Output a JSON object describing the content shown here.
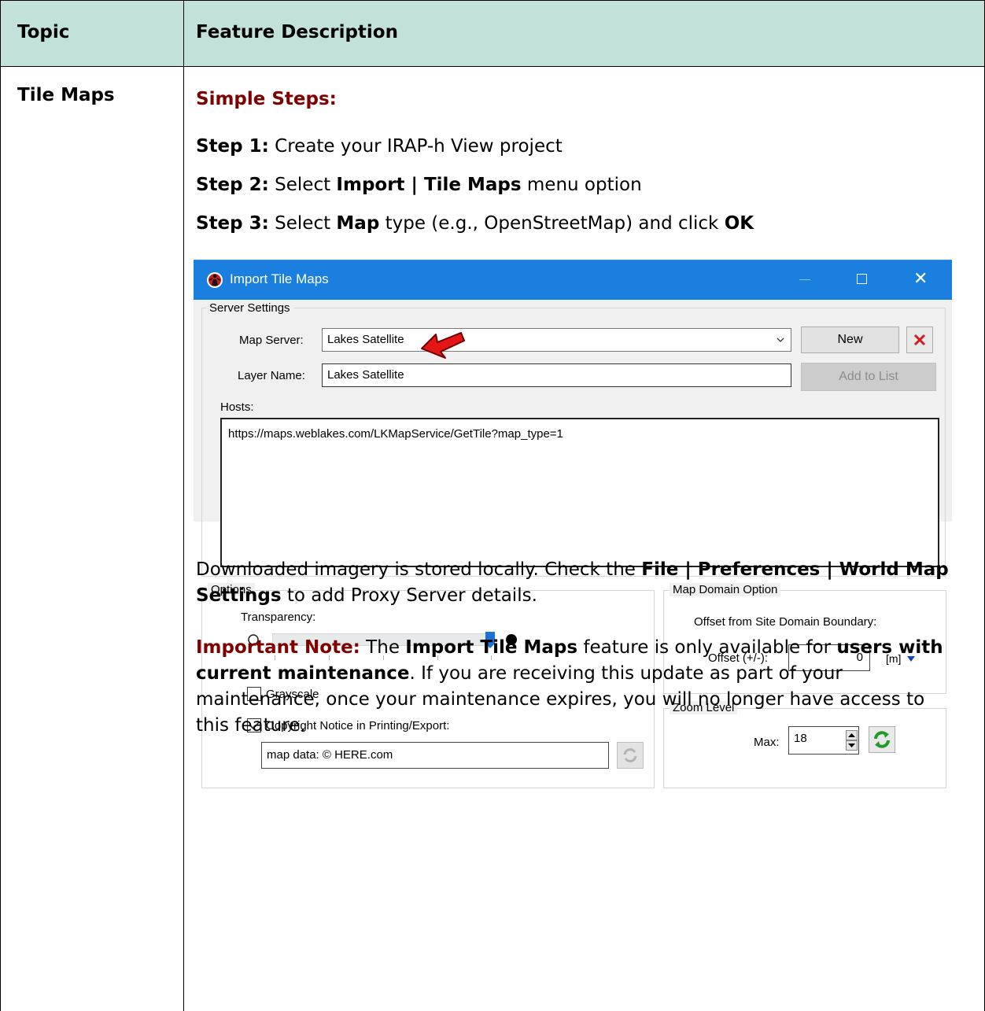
{
  "table": {
    "headers": [
      "Topic",
      "Feature Description"
    ],
    "topic": "Tile Maps",
    "simple_steps_heading": "Simple Steps:",
    "steps": [
      {
        "label": "Step 1:",
        "parts": [
          " Create your IRAP-h View project"
        ]
      },
      {
        "label": "Step 2:",
        "parts": [
          " Select ",
          "Import | Tile Maps",
          " menu option"
        ]
      },
      {
        "label": "Step 3:",
        "parts": [
          " Select ",
          "Map",
          " type (e.g., OpenStreetMap) and click ",
          "OK"
        ]
      }
    ],
    "paragraph1": {
      "a": "Downloaded imagery is stored locally. Check the ",
      "b": "File | Preferences | World Map Settings",
      "c": " to add Proxy Server details."
    },
    "important": {
      "label": "Important Note:",
      "a": " The ",
      "b": "Import Tile Maps",
      "c": " feature is only available for ",
      "d": "users with current maintenance",
      "e": ". If you are receiving this update as part of your maintenance, once your maintenance expires, you will no longer have access to this feature."
    }
  },
  "dialog": {
    "title": "Import Tile Maps",
    "server_settings": {
      "group_label": "Server Settings",
      "map_server_label": "Map Server:",
      "map_server_value": "Lakes Satellite",
      "layer_name_label": "Layer Name:",
      "layer_name_value": "Lakes Satellite",
      "new_button": "New",
      "add_to_list_button": "Add to List",
      "hosts_label": "Hosts:",
      "hosts_value": "https://maps.weblakes.com/LKMapService/GetTile?map_type=1"
    },
    "options": {
      "group_label": "Options",
      "transparency_label": "Transparency:",
      "transparency_level": 0.97,
      "grayscale_label": "Grayscale",
      "grayscale_checked": false,
      "copyright_label": "Copyright Notice in Printing/Export:",
      "copyright_checked": true,
      "copyright_value": "map data: © HERE.com"
    },
    "map_domain": {
      "group_label": "Map Domain Option",
      "offset_heading": "Offset from Site Domain Boundary:",
      "offset_label": "Offset (+/-):",
      "offset_value": "0",
      "unit": "[m]"
    },
    "zoom": {
      "group_label": "Zoom Level",
      "max_label": "Max:",
      "max_value": "18"
    }
  },
  "colors": {
    "header_bg": "#c2e1da",
    "heading_red": "#800000",
    "titlebar_blue": "#1b7fe0"
  }
}
